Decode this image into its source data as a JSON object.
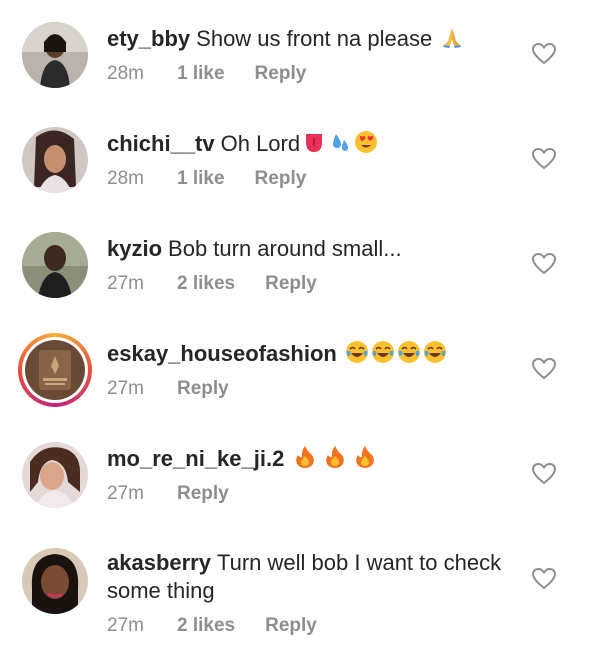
{
  "comments": [
    {
      "username": "ety_bby",
      "text": "Show us front na please",
      "emojis": [
        "folded-hands"
      ],
      "time": "28m",
      "likes": "1 like",
      "reply": "Reply"
    },
    {
      "username": "chichi__tv",
      "text": "Oh Lord",
      "emojis": [
        "tongue",
        "sweat-droplets",
        "heart-eyes"
      ],
      "time": "28m",
      "likes": "1 like",
      "reply": "Reply"
    },
    {
      "username": "kyzio",
      "text": "Bob turn around small...",
      "emojis": [],
      "time": "27m",
      "likes": "2 likes",
      "reply": "Reply"
    },
    {
      "username": "eskay_houseofashion",
      "text": "",
      "emojis": [
        "tears-of-joy",
        "tears-of-joy",
        "tears-of-joy",
        "tears-of-joy"
      ],
      "time": "27m",
      "likes": "",
      "reply": "Reply"
    },
    {
      "username": "mo_re_ni_ke_ji.2",
      "text": "",
      "emojis": [
        "fire",
        "fire",
        "fire"
      ],
      "time": "27m",
      "likes": "",
      "reply": "Reply"
    },
    {
      "username": "akasberry",
      "text": "Turn well bob I want to check some thing",
      "emojis": [],
      "time": "27m",
      "likes": "2 likes",
      "reply": "Reply"
    }
  ],
  "colors": {
    "text": "#262626",
    "meta": "#8e8e8e",
    "story_ring": "#e9503d"
  }
}
